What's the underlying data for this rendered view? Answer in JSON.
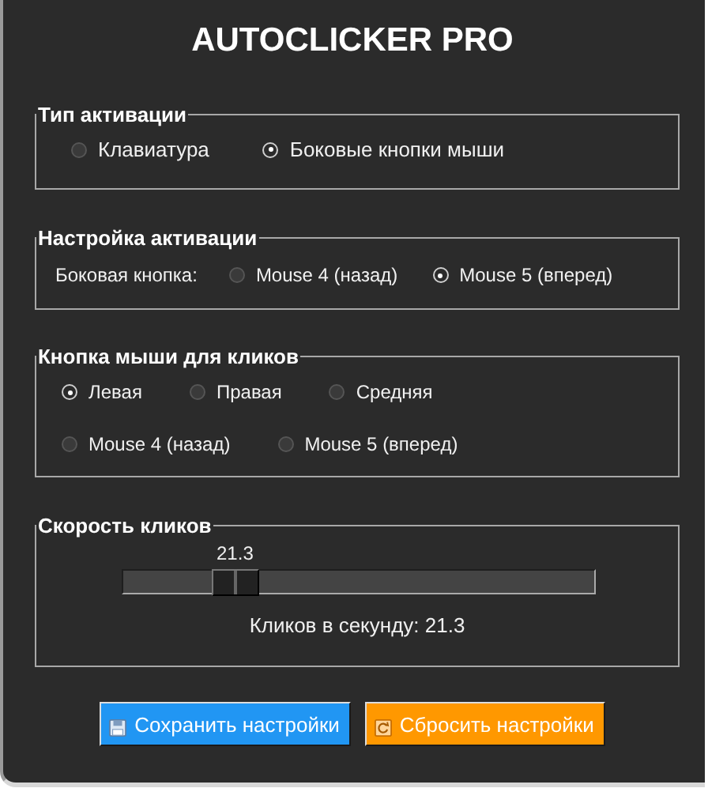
{
  "title": "AUTOCLICKER PRO",
  "activation_type": {
    "title": "Тип активации",
    "options": [
      {
        "label": "Клавиатура",
        "selected": false
      },
      {
        "label": "Боковые кнопки мыши",
        "selected": true
      }
    ]
  },
  "activation_setup": {
    "title": "Настройка активации",
    "label": "Боковая кнопка:",
    "options": [
      {
        "label": "Mouse 4 (назад)",
        "selected": false
      },
      {
        "label": "Mouse 5 (вперед)",
        "selected": true
      }
    ]
  },
  "click_button": {
    "title": "Кнопка мыши для кликов",
    "options": [
      {
        "label": "Левая",
        "selected": true
      },
      {
        "label": "Правая",
        "selected": false
      },
      {
        "label": "Средняя",
        "selected": false
      },
      {
        "label": "Mouse 4 (назад)",
        "selected": false
      },
      {
        "label": "Mouse 5 (вперед)",
        "selected": false
      }
    ]
  },
  "speed": {
    "title": "Скорость кликов",
    "value_label": "21.3",
    "level": 0.21,
    "reading": "Кликов в секунду: 21.3"
  },
  "buttons": [
    {
      "label": "Сохранить настройки",
      "kind": "save"
    },
    {
      "label": "Сбросить настройки",
      "kind": "reset"
    }
  ]
}
